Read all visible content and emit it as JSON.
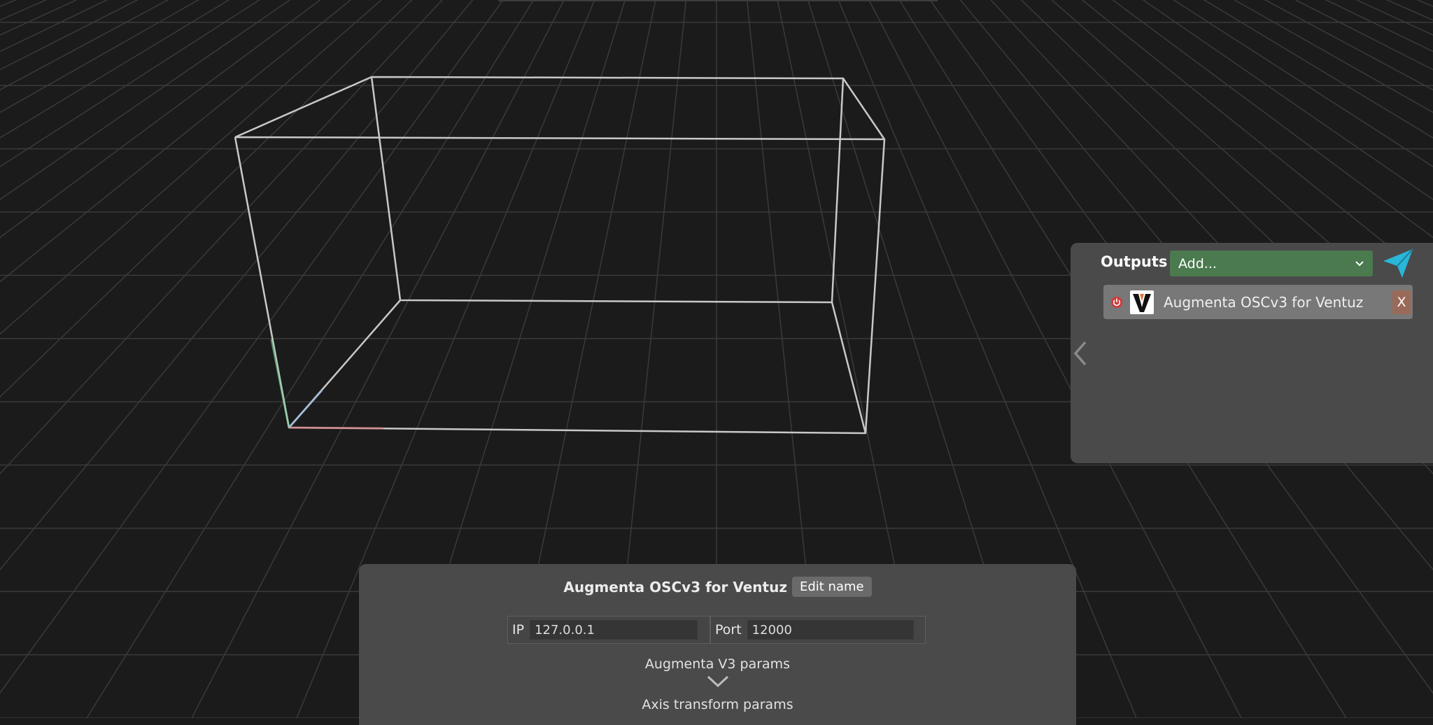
{
  "viewport": {
    "label": "3D view"
  },
  "outputs": {
    "title": "Outputs",
    "add_select": {
      "value": "Add..."
    },
    "items": [
      {
        "name": "Augmenta OSCv3 for Ventuz",
        "remove_label": "X"
      }
    ]
  },
  "editor": {
    "title": "Augmenta OSCv3 for Ventuz",
    "edit_name_label": "Edit name",
    "ip": {
      "label": "IP",
      "value": "127.0.0.1"
    },
    "port": {
      "label": "Port",
      "value": "12000"
    },
    "sections": [
      "Augmenta V3 params",
      "Axis transform params"
    ]
  },
  "colors": {
    "background": "#1b1b1b",
    "panel": "#4a4a4a",
    "add_select": "#4a7a4e",
    "send_icon": "#29b6d8",
    "power_icon": "#e05050",
    "remove_button": "#9a6a58"
  },
  "icons": [
    "chevron-left-icon",
    "chevron-down-icon",
    "send-icon",
    "power-icon",
    "ventuz-logo-icon",
    "dropdown-caret-icon"
  ]
}
